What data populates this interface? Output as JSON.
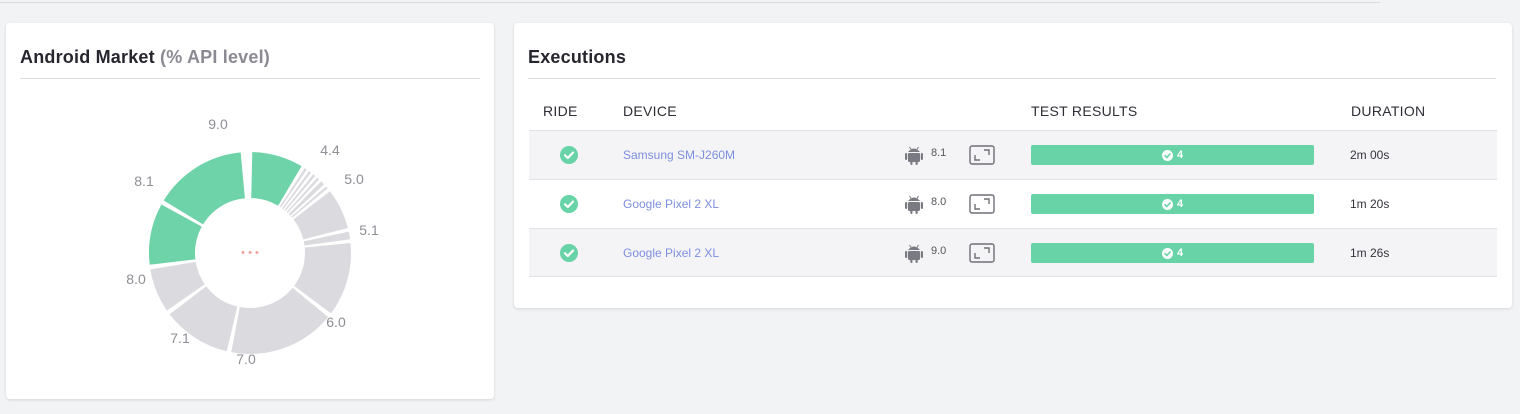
{
  "market": {
    "title": "Android Market",
    "subtitle": "(% API level)",
    "center_text": "• • •",
    "colors": {
      "highlight": "#6fd3a9",
      "default": "#dadadf"
    },
    "slices": [
      {
        "label": "9.0",
        "highlighted": true
      },
      {
        "label": "",
        "highlighted": false
      },
      {
        "label": "",
        "highlighted": false
      },
      {
        "label": "",
        "highlighted": false
      },
      {
        "label": "",
        "highlighted": false
      },
      {
        "label": "",
        "highlighted": false
      },
      {
        "label": "",
        "highlighted": false
      },
      {
        "label": "4.4",
        "highlighted": false
      },
      {
        "label": "5.0",
        "highlighted": false
      },
      {
        "label": "5.1",
        "highlighted": false
      },
      {
        "label": "6.0",
        "highlighted": false
      },
      {
        "label": "7.0",
        "highlighted": false
      },
      {
        "label": "7.1",
        "highlighted": false
      },
      {
        "label": "8.0",
        "highlighted": true
      },
      {
        "label": "8.1",
        "highlighted": true
      }
    ]
  },
  "executions": {
    "title": "Executions",
    "columns": {
      "ride": "RIDE",
      "device": "DEVICE",
      "results": "TEST RESULTS",
      "duration": "DURATION"
    },
    "rows": [
      {
        "device": "Samsung SM-J260M",
        "os": "8.1",
        "passed": "4",
        "duration": "2m 00s"
      },
      {
        "device": "Google Pixel 2 XL",
        "os": "8.0",
        "passed": "4",
        "duration": "1m 20s"
      },
      {
        "device": "Google Pixel 2 XL",
        "os": "9.0",
        "passed": "4",
        "duration": "1m 26s"
      }
    ],
    "colors": {
      "ok": "#68d3a6",
      "link": "#7d8fe0"
    }
  }
}
